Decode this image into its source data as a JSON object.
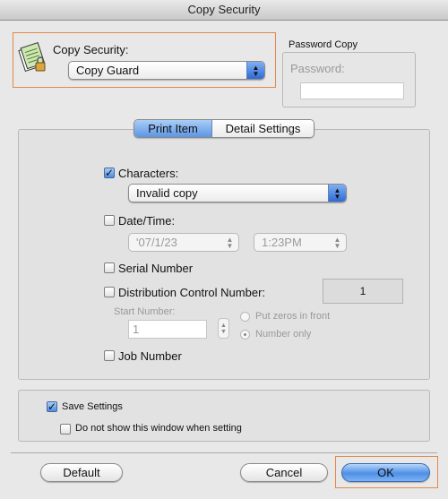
{
  "window": {
    "title": "Copy Security"
  },
  "copy_security": {
    "label": "Copy Security:",
    "selected": "Copy Guard"
  },
  "password_copy": {
    "group_label": "Password Copy",
    "password_label": "Password:",
    "password_value": ""
  },
  "tabs": {
    "print_item": "Print Item",
    "detail_settings": "Detail Settings"
  },
  "print_item": {
    "characters": {
      "label": "Characters:",
      "checked": true,
      "selected": "Invalid copy"
    },
    "date_time": {
      "label": "Date/Time:",
      "checked": false,
      "date_value": "'07/1/23",
      "time_value": "1:23PM"
    },
    "serial_number": {
      "label": "Serial Number",
      "checked": false
    },
    "distribution_control": {
      "label": "Distribution Control Number:",
      "checked": false,
      "value": "1",
      "start_number_label": "Start Number:",
      "start_number_value": "1",
      "put_zeros_label": "Put zeros in front",
      "number_only_label": "Number only",
      "selected_option": "Number only"
    },
    "job_number": {
      "label": "Job Number",
      "checked": false
    }
  },
  "settings": {
    "save_settings": {
      "label": "Save Settings",
      "checked": true
    },
    "do_not_show": {
      "label": "Do not show this window when setting",
      "checked": false
    }
  },
  "buttons": {
    "default": "Default",
    "cancel": "Cancel",
    "ok": "OK"
  },
  "colors": {
    "highlight": "#e0894a",
    "accent_blue": "#4e8fe6"
  }
}
